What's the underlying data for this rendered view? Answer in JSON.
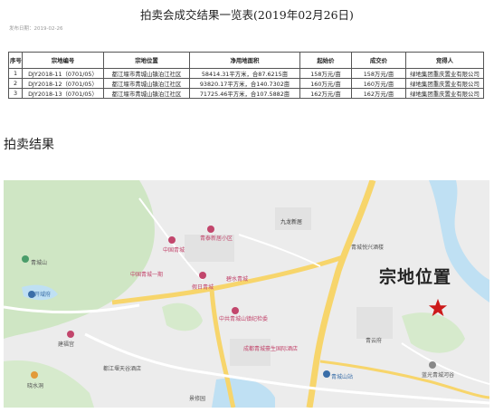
{
  "document": {
    "title": "拍卖会成交结果一览表(2019年02月26日)",
    "date_line": "发布日期：2019-02-26"
  },
  "table": {
    "headers": [
      "序号",
      "宗地编号",
      "宗地位置",
      "净用地面积",
      "起始价",
      "成交价",
      "竞得人"
    ],
    "rows": [
      [
        "1",
        "DJY2018-11（0701/05）",
        "都江堰市青城山镇泊江社区",
        "58414.31平方米，合87.6215亩",
        "158万元/亩",
        "158万元/亩",
        "绿地集团重庆置业有限公司"
      ],
      [
        "2",
        "DJY2018-12（0701/05）",
        "都江堰市青城山镇泊江社区",
        "93820.17平方米，合140.7302亩",
        "160万元/亩",
        "160万元/亩",
        "绿地集团重庆置业有限公司"
      ],
      [
        "3",
        "DJY2018-13（0701/05）",
        "都江堰市青城山镇泊江社区",
        "71725.46平方米，合107.5882亩",
        "162万元/亩",
        "162万元/亩",
        "绿地集团重庆置业有限公司"
      ]
    ]
  },
  "section": {
    "heading": "拍卖结果"
  },
  "map": {
    "marker_label": "宗地位置",
    "labels": {
      "jiulong": "九龙新居",
      "qingxing": "青城悦兴酒楼",
      "zhongguo_qingcheng": "中国青城",
      "qingtai": "青泰新居小区",
      "zhongguo_qingcheng_yihao": "中国青城一期",
      "jiari": "假日青城",
      "bishui": "碧水青城",
      "qingcheng_shan_label": "青城山",
      "kaiyuan": "开域府",
      "zhonggong": "中共青城山镇纪检委",
      "qingyun": "青云府",
      "chengdu_hotel": "成都青城豪生国际酒店",
      "jiantang": "建福宫",
      "dujiang_hotel": "都江堰天谷酒店",
      "qingcheng_station": "青城山站",
      "lanbao": "蓝光青城河谷",
      "xiaoshui": "晓水洞",
      "jingxiu": "景修园"
    },
    "colors": {
      "road": "#f7d56b",
      "green": "#cfe6c4",
      "water": "#bfe0f3",
      "marker": "#cc1a1a"
    }
  }
}
